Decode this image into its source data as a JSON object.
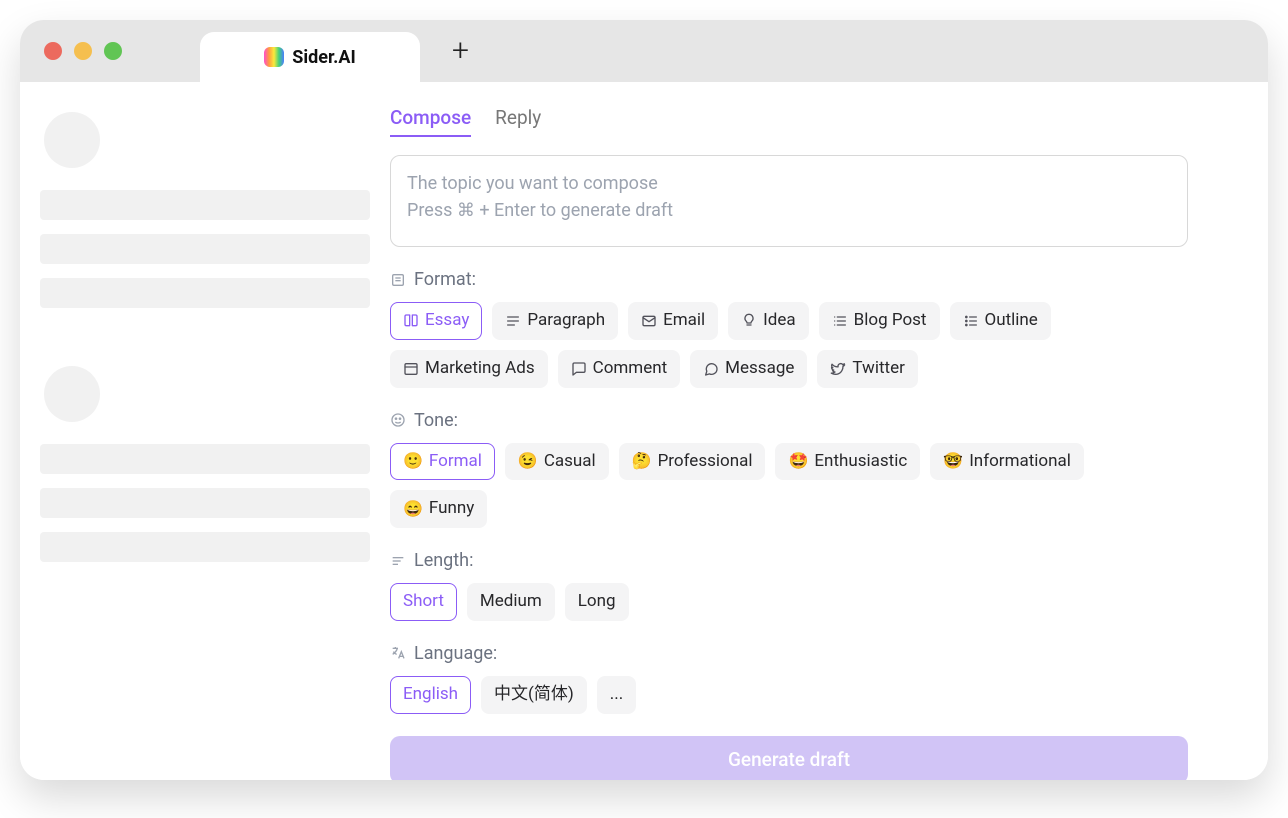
{
  "window": {
    "tab_title": "Sider.AI"
  },
  "tabs": {
    "compose": "Compose",
    "reply": "Reply",
    "active": "compose"
  },
  "prompt": {
    "line1": "The topic you want to compose",
    "line2": "Press ⌘ + Enter to generate draft"
  },
  "sections": {
    "format": {
      "label": "Format:"
    },
    "tone": {
      "label": "Tone:"
    },
    "length": {
      "label": "Length:"
    },
    "language": {
      "label": "Language:"
    }
  },
  "format": {
    "selected": "Essay",
    "options": [
      "Essay",
      "Paragraph",
      "Email",
      "Idea",
      "Blog Post",
      "Outline",
      "Marketing Ads",
      "Comment",
      "Message",
      "Twitter"
    ]
  },
  "tone": {
    "selected": "Formal",
    "options": [
      {
        "label": "Formal",
        "emoji": "🙂"
      },
      {
        "label": "Casual",
        "emoji": "😉"
      },
      {
        "label": "Professional",
        "emoji": "🤔"
      },
      {
        "label": "Enthusiastic",
        "emoji": "🤩"
      },
      {
        "label": "Informational",
        "emoji": "🤓"
      },
      {
        "label": "Funny",
        "emoji": "😄"
      }
    ]
  },
  "length": {
    "selected": "Short",
    "options": [
      "Short",
      "Medium",
      "Long"
    ]
  },
  "language": {
    "selected": "English",
    "options": [
      "English",
      "中文(简体)",
      "..."
    ]
  },
  "generate_label": "Generate draft",
  "colors": {
    "accent": "#8b5cf6",
    "accent_light": "#d1c4f6",
    "chip_bg": "#f4f4f5",
    "text": "#27272a",
    "muted": "#6b7280"
  },
  "format_icons": {
    "Essay": "book",
    "Paragraph": "lines",
    "Email": "mail",
    "Idea": "bulb",
    "Blog Post": "blog",
    "Outline": "list",
    "Marketing Ads": "window",
    "Comment": "comment",
    "Message": "message",
    "Twitter": "twitter"
  }
}
